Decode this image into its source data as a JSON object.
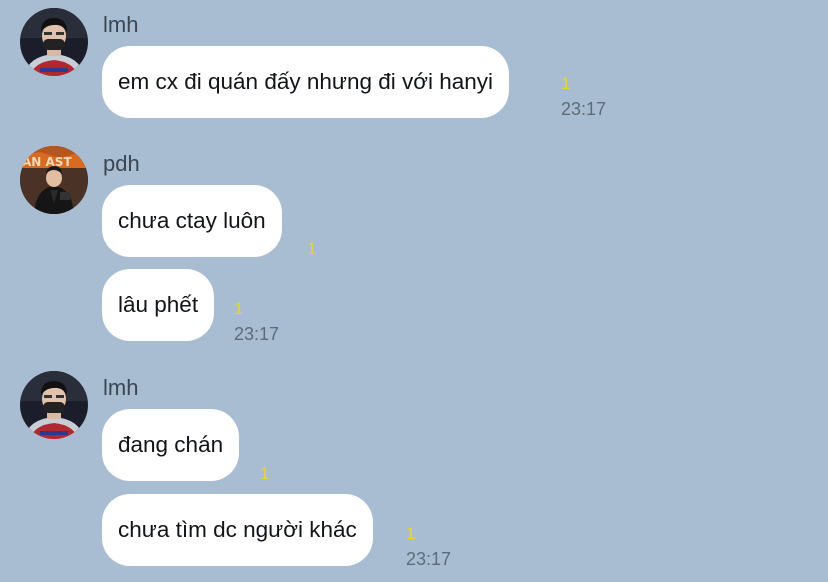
{
  "chat": {
    "messages": [
      {
        "sender": "lmh",
        "text": "em cx đi quán đấy nhưng đi với hanyi",
        "read_count": "1",
        "time": "23:17"
      },
      {
        "sender": "pdh",
        "text": "chưa ctay luôn",
        "read_count": "1",
        "time": ""
      },
      {
        "sender": "pdh",
        "text": "lâu phết",
        "read_count": "1",
        "time": "23:17"
      },
      {
        "sender": "lmh",
        "text": "đang chán",
        "read_count": "1",
        "time": ""
      },
      {
        "sender": "lmh",
        "text": "chưa tìm dc người khác",
        "read_count": "1",
        "time": "23:17"
      }
    ]
  },
  "colors": {
    "background": "#a9bdd2",
    "bubble": "#ffffff",
    "read_indicator": "#e8d62a",
    "timestamp": "#5e6b79"
  },
  "icons": {
    "lmh_avatar": "person-avatar-icon",
    "pdh_avatar": "person-avatar-icon"
  }
}
